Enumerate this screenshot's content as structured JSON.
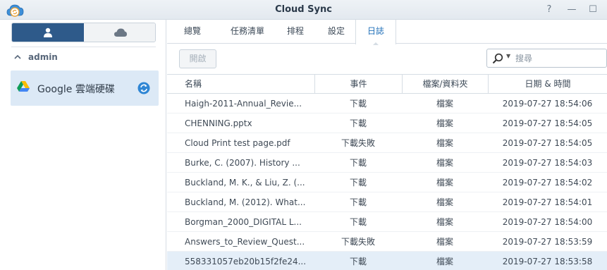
{
  "window": {
    "title": "Cloud Sync",
    "controls": {
      "help": "?",
      "minimize": "—",
      "maximize": "☐"
    }
  },
  "sidebar": {
    "account_group": "admin",
    "connection_label": "Google 雲端硬碟"
  },
  "tabs": [
    {
      "label": "總覽"
    },
    {
      "label": "任務清單"
    },
    {
      "label": "排程"
    },
    {
      "label": "設定"
    },
    {
      "label": "日誌"
    }
  ],
  "active_tab": "日誌",
  "toolbar": {
    "open_label": "開啟",
    "search_placeholder": "搜尋"
  },
  "table": {
    "columns": [
      "名稱",
      "事件",
      "檔案/資料夾",
      "日期 & 時間"
    ],
    "rows": [
      {
        "name": "Haigh-2011-Annual_Revie...",
        "event": "下載",
        "type": "檔案",
        "time": "2019-07-27 18:54:06"
      },
      {
        "name": "CHENNING.pptx",
        "event": "下載",
        "type": "檔案",
        "time": "2019-07-27 18:54:05"
      },
      {
        "name": "Cloud Print test page.pdf",
        "event": "下載失敗",
        "type": "檔案",
        "time": "2019-07-27 18:54:05"
      },
      {
        "name": "Burke, C. (2007). History ...",
        "event": "下載",
        "type": "檔案",
        "time": "2019-07-27 18:54:03"
      },
      {
        "name": "Buckland, M. K., & Liu, Z. (...",
        "event": "下載",
        "type": "檔案",
        "time": "2019-07-27 18:54:02"
      },
      {
        "name": "Buckland, M. (2012). What...",
        "event": "下載",
        "type": "檔案",
        "time": "2019-07-27 18:54:01"
      },
      {
        "name": "Borgman_2000_DIGITAL L...",
        "event": "下載",
        "type": "檔案",
        "time": "2019-07-27 18:54:00"
      },
      {
        "name": "Answers_to_Review_Quest...",
        "event": "下載失敗",
        "type": "檔案",
        "time": "2019-07-27 18:53:59"
      },
      {
        "name": "558331057eb20b15f2fe24...",
        "event": "下載",
        "type": "檔案",
        "time": "2019-07-27 18:53:58"
      }
    ],
    "selected_row": 8
  },
  "colors": {
    "accent": "#1f6fb8",
    "segment_active": "#2e5a8a",
    "selection": "#dce9f6"
  },
  "icons": {
    "app": "cloud-sync-app-icon",
    "user": "user-icon",
    "cloud": "cloud-icon",
    "drive": "google-drive-icon",
    "sync": "sync-icon",
    "search": "search-icon"
  }
}
